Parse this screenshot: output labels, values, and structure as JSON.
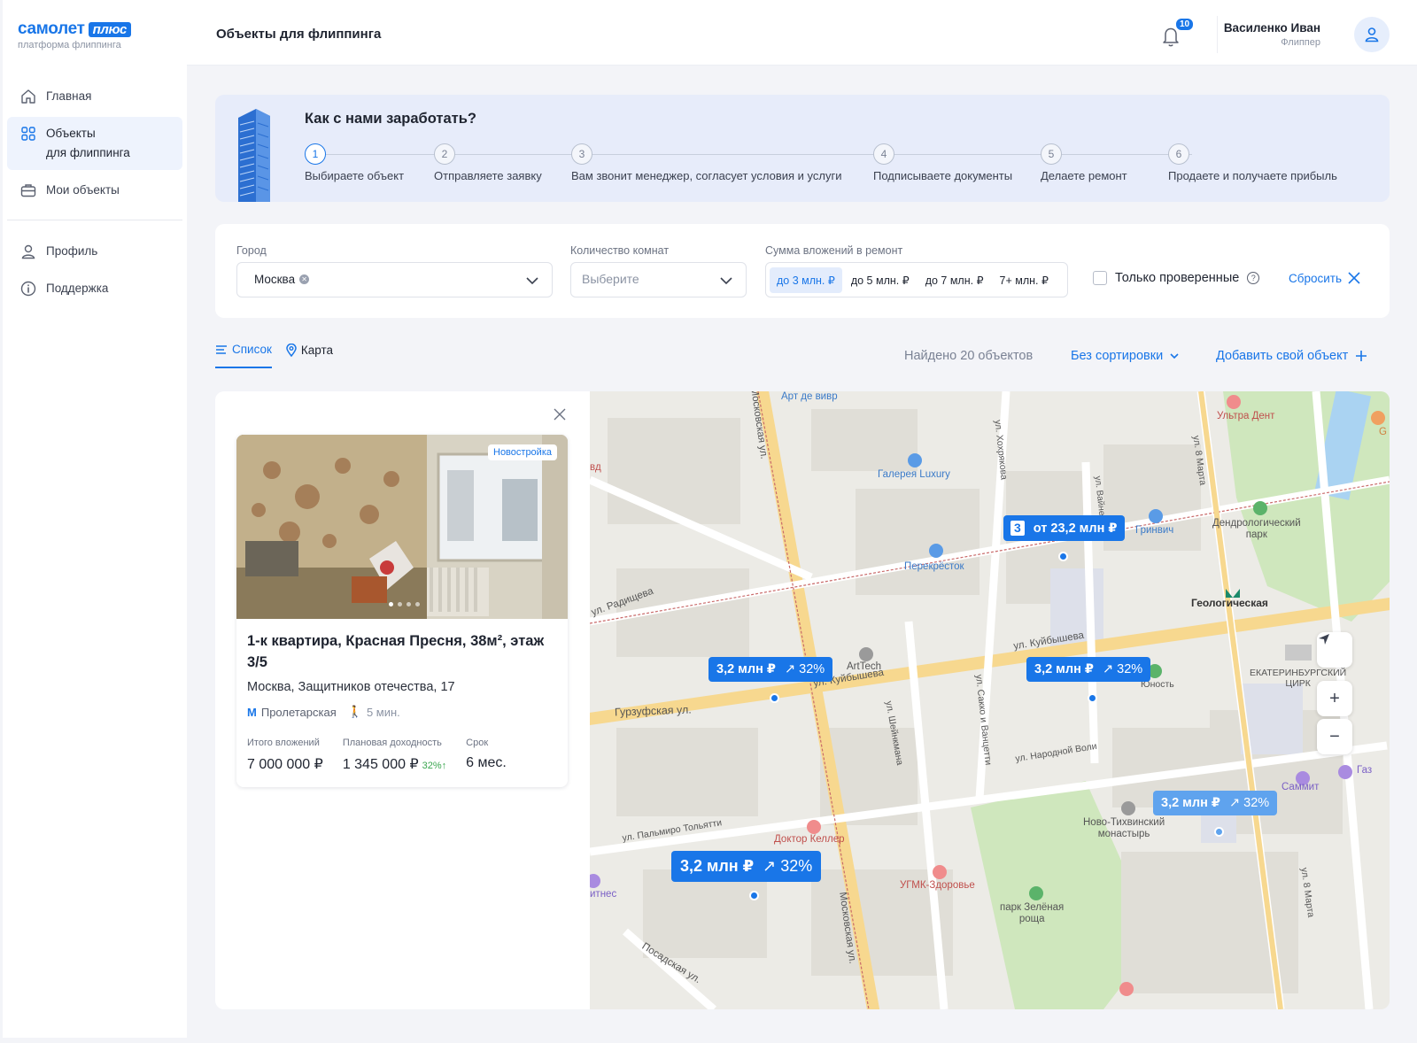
{
  "brand": {
    "name": "самолет",
    "plus": "плюс",
    "subtitle": "платформа флиппинга"
  },
  "sidebar": {
    "items": [
      {
        "label": "Главная",
        "icon": "home-icon"
      },
      {
        "label": "Объекты\nдля флиппинга",
        "icon": "grid-icon",
        "active": true
      },
      {
        "label": "Мои объекты",
        "icon": "briefcase-icon"
      },
      {
        "label": "Профиль",
        "icon": "user-icon"
      },
      {
        "label": "Поддержка",
        "icon": "info-icon"
      }
    ]
  },
  "header": {
    "title": "Объекты для флиппинга",
    "notifications": "10",
    "user_name": "Василенко Иван",
    "user_role": "Флиппер"
  },
  "banner": {
    "title": "Как с нами заработать?",
    "steps": [
      {
        "num": "1",
        "label": "Выбираете объект"
      },
      {
        "num": "2",
        "label": "Отправляете заявку"
      },
      {
        "num": "3",
        "label": "Вам звонит менеджер, согласует условия и услуги"
      },
      {
        "num": "4",
        "label": "Подписываете документы"
      },
      {
        "num": "5",
        "label": "Делаете ремонт"
      },
      {
        "num": "6",
        "label": "Продаете и получаете прибыль"
      }
    ]
  },
  "filters": {
    "city_label": "Город",
    "city_value": "Москва",
    "rooms_label": "Количество комнат",
    "rooms_placeholder": "Выберите",
    "sum_label": "Сумма вложений в ремонт",
    "sum_options": [
      "до 3 млн. ₽",
      "до 5 млн. ₽",
      "до 7 млн. ₽",
      "7+ млн. ₽"
    ],
    "sum_selected": "до 3 млн. ₽",
    "verified_label": "Только проверенные",
    "reset_label": "Сбросить"
  },
  "view": {
    "tab_list": "Список",
    "tab_map": "Карта",
    "found": "Найдено 20 объектов",
    "sort": "Без сортировки",
    "add": "Добавить свой объект"
  },
  "card": {
    "badge": "Новостройка",
    "title": "1-к квартира, Красная Пресня, 38м², этаж 3/5",
    "address": "Москва, Защитников отечества, 17",
    "metro": "Пролетарская",
    "walk": "5 мин.",
    "invest_label": "Итого вложений",
    "invest_value": "7 000 000 ₽",
    "profit_label": "Плановая доходность",
    "profit_value": "1 345 000 ₽",
    "profit_pct": "32%↑",
    "term_label": "Срок",
    "term_value": "6 мес."
  },
  "map": {
    "markers": [
      {
        "count": "3",
        "price": "от 23,2 млн ₽"
      },
      {
        "price": "3,2 млн ₽",
        "pct": "↗ 32%"
      },
      {
        "price": "3,2 млн ₽",
        "pct": "↗ 32%"
      },
      {
        "price": "3,2 млн ₽",
        "pct": "↗ 32%"
      },
      {
        "price": "3,2 млн ₽",
        "pct": "↗ 32%"
      }
    ],
    "labels": {
      "art": "Арт де вивр",
      "ultra": "Ультра Дент",
      "galereya": "Галерея Luxury",
      "grinvich": "Гринвич",
      "dendro": "Дендрологический\nпарк",
      "perekrestok": "Перекрёсток",
      "geolog": "Геологическая",
      "kuib": "ул. Куйбышева",
      "kuib2": "ул. Куйбышева",
      "artech": "ArtTech",
      "yunost": "Юность",
      "circus": "ЕКАТЕРИНБУРГСКИЙ\nЦИРК",
      "gurz": "Гурзуфская ул.",
      "shein": "ул. Шейнкмана",
      "sacco": "ул. Сакко и Ванцетти",
      "narod": "ул. Народной Воли",
      "radish": "ул. Радищева",
      "mosk": "Московская ул.",
      "mosk2": "Московская ул.",
      "khokh": "ул. Хохрякова",
      "vainera": "ул. Вайнера",
      "march": "ул. 8 Марта",
      "march2": "ул. 8 Марта",
      "palm": "ул. Пальмиро Тольятти",
      "keller": "Доктор Келлер",
      "ugmk": "УГМК-Здоровье",
      "zel": "парк Зелёная\nроща",
      "novo": "Ново-Тихвинский\nмонастырь",
      "sammit": "Саммит",
      "gaz": "Газ",
      "posad": "Посадская ул.",
      "fitness": "итнес",
      "vd": "вд",
      "g": "G"
    },
    "zoom_in": "+",
    "zoom_out": "−"
  }
}
